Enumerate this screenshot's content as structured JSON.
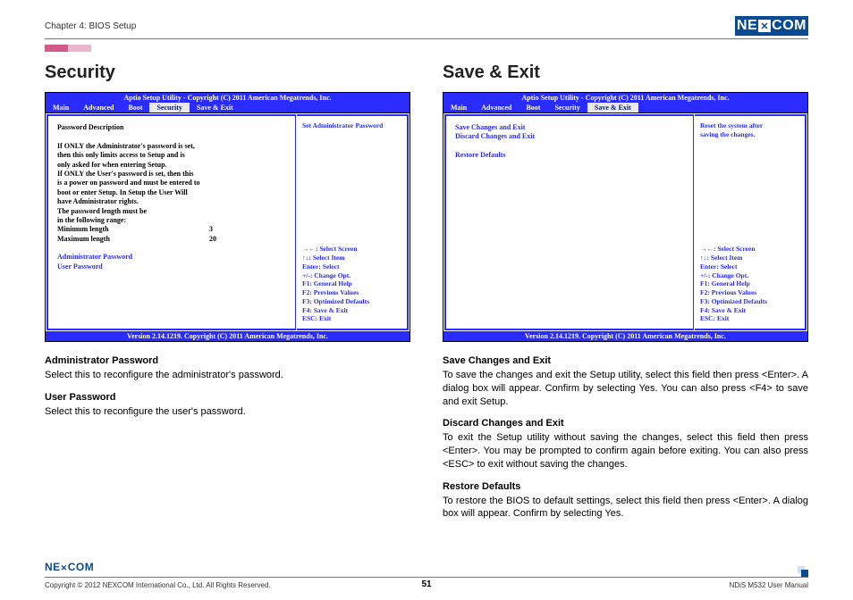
{
  "header": {
    "chapter": "Chapter 4: BIOS Setup",
    "logo_text_1": "NE",
    "logo_text_2": "COM"
  },
  "bios_common": {
    "title": "Aptio Setup Utility - Copyright (C) 2011 American Megatrends, Inc.",
    "tabs": [
      "Main",
      "Advanced",
      "Boot",
      "Security",
      "Save & Exit"
    ],
    "footer": "Version 2.14.1219. Copyright (C) 2011 American Megatrends, Inc.",
    "help": {
      "l1": "→←: Select Screen",
      "l2": "↑↓: Select Item",
      "l3": "Enter: Select",
      "l4": "+/-: Change Opt.",
      "l5": "F1: General Help",
      "l6": "F2: Previous Values",
      "l7": "F3: Optimized Defaults",
      "l8": "F4: Save & Exit",
      "l9": "ESC: Exit"
    }
  },
  "left": {
    "heading": "Security",
    "side_top": "Set Administrator Password",
    "body": {
      "t1": "Password Description",
      "t2": "If ONLY the Administrator's password is set,",
      "t3": "then this only limits access to Setup and is",
      "t4": "only asked for when entering Setup.",
      "t5": "If ONLY the User's password is set, then this",
      "t6": "is a power on password and must be entered to",
      "t7": "boot or enter Setup. In Setup the User Will",
      "t8": "have Administrator rights.",
      "t9": "The password length must be",
      "t10": "in the following range:",
      "min_lbl": "Minimum length",
      "min_val": "3",
      "max_lbl": "Maximum length",
      "max_val": "20",
      "admin": "Administrator Password",
      "user": "User Password"
    },
    "desc": {
      "h1": "Administrator Password",
      "p1": "Select this to reconfigure the administrator's password.",
      "h2": "User Password",
      "p2": "Select this to reconfigure the user's password."
    }
  },
  "right": {
    "heading": "Save & Exit",
    "side_top1": "Reset the system after",
    "side_top2": "saving the changes.",
    "body": {
      "t1": "Save Changes and Exit",
      "t2": "Discard Changes and Exit",
      "t3": "Restore Defaults"
    },
    "desc": {
      "h1": "Save Changes and Exit",
      "p1": "To save the changes and exit the Setup utility, select this field then press <Enter>. A dialog box will appear. Confirm by selecting Yes. You can also press <F4> to save and exit Setup.",
      "h2": "Discard Changes and Exit",
      "p2": "To exit the Setup utility without saving the changes, select this field then press <Enter>. You may be prompted to confirm again before exiting. You can also press <ESC> to exit without saving the changes.",
      "h3": "Restore Defaults",
      "p3": "To restore the BIOS to default settings, select this field then press <Enter>. A dialog box will appear. Confirm by selecting Yes."
    }
  },
  "footer": {
    "copyright": "Copyright © 2012 NEXCOM International Co., Ltd. All Rights Reserved.",
    "page": "51",
    "manual": "NDiS M532 User Manual"
  }
}
